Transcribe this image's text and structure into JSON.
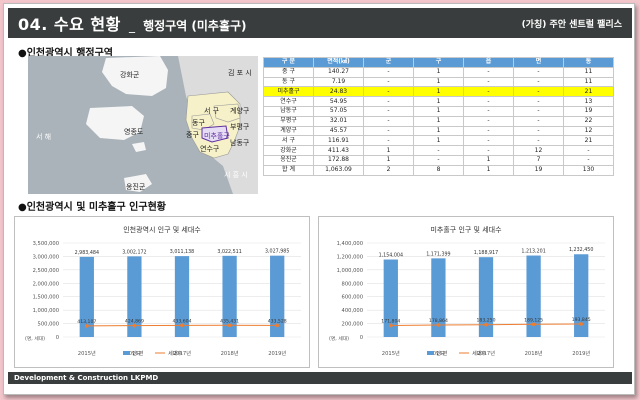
{
  "header": {
    "number": "04. 수요 현황",
    "separator": "_",
    "subtitle": "행정구역 (미추홀구)",
    "project": "(가칭) 주안 센트럴 팰리스"
  },
  "section1_title": "●인천광역시 행정구역",
  "section2_title": "●인천광역시 및 미추홀구 인구현황",
  "map": {
    "labels": {
      "ganghwa": "강화군",
      "gimpo": "김 포 시",
      "seo": "서 구",
      "gyeyang": "계양구",
      "bupyeong": "부평구",
      "dong": "동구",
      "jung": "중구",
      "michuhol": "미추홀구",
      "namdong": "남동구",
      "yeonsu": "연수구",
      "yeongjong": "영종도",
      "ongjin": "옹진군",
      "sea": "서 해",
      "siheung": "시 흥 시"
    },
    "colors": {
      "sea": "#aab3b9",
      "land_east": "#dcdcdc",
      "island": "#f5f5f5",
      "district_fill": "#f6f1c8",
      "highlight": "#5e2ea0"
    }
  },
  "table": {
    "headers": [
      "구 분",
      "면적(㎢)",
      "군",
      "구",
      "읍",
      "면",
      "동"
    ],
    "rows": [
      [
        "중 구",
        "140.27",
        "-",
        "1",
        "-",
        "-",
        "11"
      ],
      [
        "동 구",
        "7.19",
        "-",
        "1",
        "-",
        "-",
        "11"
      ],
      [
        "미추홀구",
        "24.83",
        "-",
        "1",
        "-",
        "-",
        "21"
      ],
      [
        "연수구",
        "54.95",
        "-",
        "1",
        "-",
        "-",
        "13"
      ],
      [
        "남동구",
        "57.05",
        "-",
        "1",
        "-",
        "-",
        "19"
      ],
      [
        "부평구",
        "32.01",
        "-",
        "1",
        "-",
        "-",
        "22"
      ],
      [
        "계양구",
        "45.57",
        "-",
        "1",
        "-",
        "-",
        "12"
      ],
      [
        "서 구",
        "116.91",
        "-",
        "1",
        "-",
        "-",
        "21"
      ],
      [
        "강화군",
        "411.43",
        "1",
        "-",
        "-",
        "12",
        "-"
      ],
      [
        "옹진군",
        "172.88",
        "1",
        "-",
        "1",
        "7",
        "-"
      ],
      [
        "합 계",
        "1,063.09",
        "2",
        "8",
        "1",
        "19",
        "130"
      ]
    ],
    "highlight_row": 2,
    "header_color": "#5b9bd5",
    "highlight_color": "#ffff00"
  },
  "chart_data": [
    {
      "type": "bar",
      "title": "인천광역시 인구 및 세대수",
      "categories": [
        "2015년",
        "2016년",
        "2017년",
        "2018년",
        "2019년"
      ],
      "unit_label": "(명, 세대)",
      "ylim": [
        0,
        3500000
      ],
      "yticks": [
        "0",
        "500,000",
        "1,000,000",
        "1,500,000",
        "2,000,000",
        "2,500,000",
        "3,000,000",
        "3,500,000"
      ],
      "series": [
        {
          "name": "인구",
          "kind": "bar",
          "color": "#5b9bd5",
          "values": [
            2983484,
            3002172,
            3011138,
            3022511,
            3027985
          ],
          "labels": [
            "2,983,484",
            "3,002,172",
            "3,011,138",
            "3,022,511",
            "3,027,985"
          ]
        },
        {
          "name": "세대수",
          "kind": "line",
          "color": "#ed7d31",
          "values": [
            413107,
            424869,
            433604,
            435431,
            433528
          ],
          "labels": [
            "413,107",
            "424,869",
            "433,604",
            "435,431",
            "433,528"
          ]
        }
      ],
      "grid": true,
      "legend": "bottom"
    },
    {
      "type": "bar",
      "title": "미추홀구 인구 및 세대수",
      "categories": [
        "2015년",
        "2016년",
        "2017년",
        "2018년",
        "2019년"
      ],
      "unit_label": "(명, 세대)",
      "ylim": [
        0,
        1400000
      ],
      "yticks": [
        "0",
        "200,000",
        "400,000",
        "600,000",
        "800,000",
        "1,000,000",
        "1,200,000",
        "1,400,000"
      ],
      "series": [
        {
          "name": "인구",
          "kind": "bar",
          "color": "#5b9bd5",
          "values": [
            1154004,
            1171399,
            1188917,
            1213201,
            1232450
          ],
          "labels": [
            "1,154,004",
            "1,171,399",
            "1,188,917",
            "1,213,201",
            "1,232,450"
          ]
        },
        {
          "name": "세대수",
          "kind": "line",
          "color": "#ed7d31",
          "values": [
            171804,
            178864,
            183250,
            189125,
            193845
          ],
          "labels": [
            "171,804",
            "178,864",
            "183,250",
            "189,125",
            "193,845"
          ]
        }
      ],
      "grid": true,
      "legend": "bottom"
    }
  ],
  "footer": "Development & Construction LKPMD"
}
